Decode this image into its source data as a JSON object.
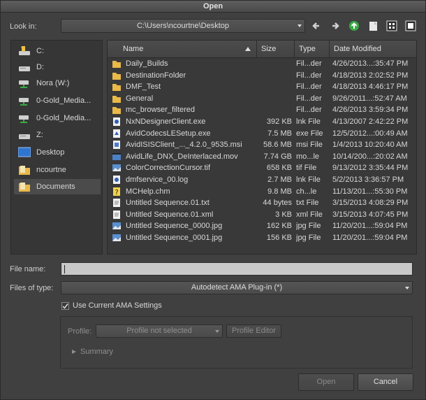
{
  "window": {
    "title": "Open"
  },
  "lookin": {
    "label": "Look in:",
    "value": "C:\\Users\\ncourtne\\Desktop"
  },
  "toolbar": [
    "back-icon",
    "forward-icon",
    "parent-folder-icon",
    "new-folder-icon",
    "list-view-icon",
    "detail-view-icon"
  ],
  "sidebar": {
    "items": [
      {
        "label": "C:",
        "icon": "drive-icon"
      },
      {
        "label": "D:",
        "icon": "drive-icon"
      },
      {
        "label": "Nora (W:)",
        "icon": "network-drive-icon"
      },
      {
        "label": "0-Gold_Media...",
        "icon": "network-drive-icon"
      },
      {
        "label": "0-Gold_Media...",
        "icon": "network-drive-icon"
      },
      {
        "label": "Z:",
        "icon": "drive-icon"
      },
      {
        "label": "Desktop",
        "icon": "desktop-icon"
      },
      {
        "label": "ncourtne",
        "icon": "folder-icon"
      },
      {
        "label": "Documents",
        "icon": "folder-icon"
      }
    ]
  },
  "filelist": {
    "columns": {
      "name": "Name",
      "size": "Size",
      "type": "Type",
      "date": "Date Modified"
    },
    "rows": [
      {
        "name": "Daily_Builds",
        "size": "",
        "type": "Fil...der",
        "date": "4/26/2013...:35:47 PM",
        "icon": "folder-icon"
      },
      {
        "name": "DestinationFolder",
        "size": "",
        "type": "Fil...der",
        "date": "4/18/2013 2:02:52 PM",
        "icon": "folder-icon"
      },
      {
        "name": "DMF_Test",
        "size": "",
        "type": "Fil...der",
        "date": "4/18/2013 4:46:17 PM",
        "icon": "folder-icon"
      },
      {
        "name": "General",
        "size": "",
        "type": "Fil...der",
        "date": "9/26/2011...:52:47 AM",
        "icon": "folder-icon"
      },
      {
        "name": "mc_browser_filtered",
        "size": "",
        "type": "Fil...der",
        "date": "4/26/2013 3:59:34 PM",
        "icon": "folder-icon"
      },
      {
        "name": "NxNDesignerClient.exe",
        "size": "392 KB",
        "type": "lnk File",
        "date": "4/13/2007 2:42:22 PM",
        "icon": "shortcut-icon"
      },
      {
        "name": "AvidCodecsLESetup.exe",
        "size": "7.5 MB",
        "type": "exe File",
        "date": "12/5/2012...:00:49 AM",
        "icon": "exe-icon"
      },
      {
        "name": "AvidISISClient_..._4.2.0_9535.msi",
        "size": "58.6 MB",
        "type": "msi File",
        "date": "1/4/2013 10:20:40 AM",
        "icon": "installer-icon"
      },
      {
        "name": "AvidLife_DNX_DeInterlaced.mov",
        "size": "7.74 GB",
        "type": "mo...le",
        "date": "10/14/200...:20:02 AM",
        "icon": "video-icon"
      },
      {
        "name": "ColorCorrectionCursor.tif",
        "size": "658 KB",
        "type": "tif File",
        "date": "9/13/2012 3:35:44 PM",
        "icon": "image-icon"
      },
      {
        "name": "dmfservice_00.log",
        "size": "2.7 MB",
        "type": "lnk File",
        "date": "5/2/2013 3:36:57 PM",
        "icon": "shortcut-icon"
      },
      {
        "name": "MCHelp.chm",
        "size": "9.8 MB",
        "type": "ch...le",
        "date": "11/13/201...:55:30 PM",
        "icon": "help-icon"
      },
      {
        "name": "Untitled Sequence.01.txt",
        "size": "44 bytes",
        "type": "txt File",
        "date": "3/15/2013 4:08:29 PM",
        "icon": "text-file-icon"
      },
      {
        "name": "Untitled Sequence.01.xml",
        "size": "3 KB",
        "type": "xml File",
        "date": "3/15/2013 4:07:45 PM",
        "icon": "text-file-icon"
      },
      {
        "name": "Untitled Sequence_0000.jpg",
        "size": "162 KB",
        "type": "jpg File",
        "date": "11/20/201...:59:04 PM",
        "icon": "image-icon"
      },
      {
        "name": "Untitled Sequence_0001.jpg",
        "size": "156 KB",
        "type": "jpg File",
        "date": "11/20/201...:59:04 PM",
        "icon": "image-icon"
      }
    ]
  },
  "filename": {
    "label": "File name:",
    "value": ""
  },
  "filetype": {
    "label": "Files of type:",
    "value": "Autodetect AMA Plug-in (*)"
  },
  "ama": {
    "checkbox_label": "Use Current AMA Settings",
    "checked": true
  },
  "profile": {
    "label": "Profile:",
    "value": "Profile not selected",
    "editor_label": "Profile Editor"
  },
  "summary": {
    "label": "Summary"
  },
  "buttons": {
    "open": "Open",
    "cancel": "Cancel"
  }
}
